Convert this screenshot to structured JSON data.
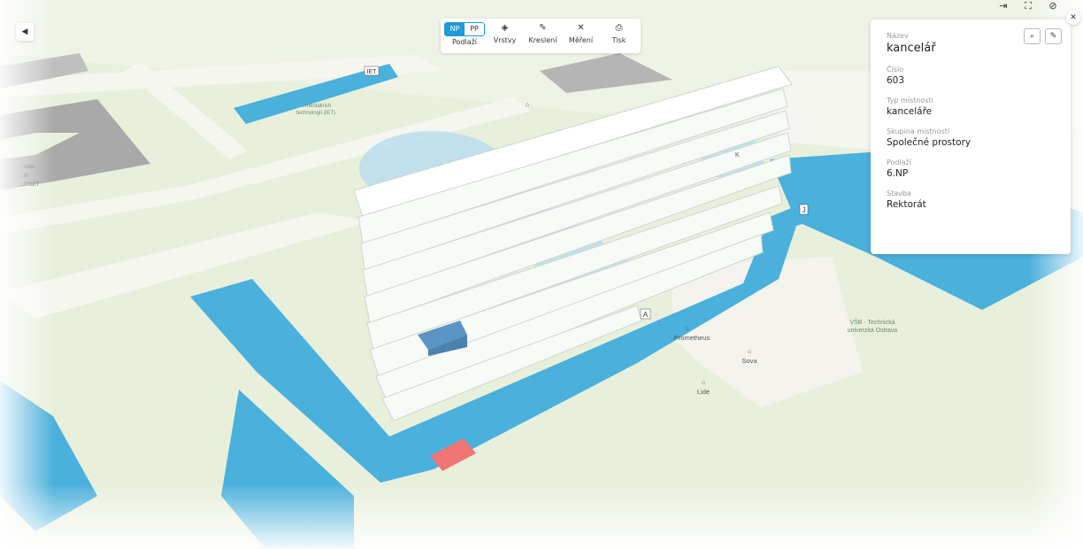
{
  "toolbar": {
    "floor_np": "NP",
    "floor_pp": "PP",
    "floors_label": "Podlaží",
    "layers_label": "Vrstvy",
    "draw_label": "Kreslení",
    "measure_label": "Měření",
    "print_label": "Tisk"
  },
  "panel": {
    "name_label": "Název",
    "name_value": "kancelář",
    "number_label": "Číslo",
    "number_value": "603",
    "type_label": "Typ místnosti",
    "type_value": "kanceláře",
    "group_label": "Skupina místnosti",
    "group_value": "Společné prostory",
    "floor_label": "Podlaží",
    "floor_value": "6.NP",
    "building_label": "Stavba",
    "building_value": "Rektorát"
  },
  "map": {
    "labels": {
      "iet": "IET",
      "iet_name_1": "...mentálních",
      "iet_name_2": "technologií (IET)",
      "left_1": "...čelo-",
      "left_2": "...tb",
      "left_3": "...PISET",
      "block_a": "A",
      "block_j": "J",
      "block_k": "K",
      "prometheus": "Prometheus",
      "sova": "Sova",
      "lide": "Lidé",
      "vsb_1": "VŠB - Technická",
      "vsb_2": "univerzita Ostrava",
      "top_left_tag": "..."
    }
  },
  "colors": {
    "accent": "#1e9bd8",
    "corridor": "#4ab0dc",
    "selected_room": "#5b95c4",
    "highlight_room": "#f07676",
    "grass": "#e4eed6",
    "road": "#f7f6f2"
  },
  "icons": {
    "logout": "logout-icon",
    "fullscreen": "fullscreen-icon",
    "visibility": "eye-off-icon",
    "close": "close-icon",
    "search": "search-icon",
    "edit": "edit-icon"
  }
}
